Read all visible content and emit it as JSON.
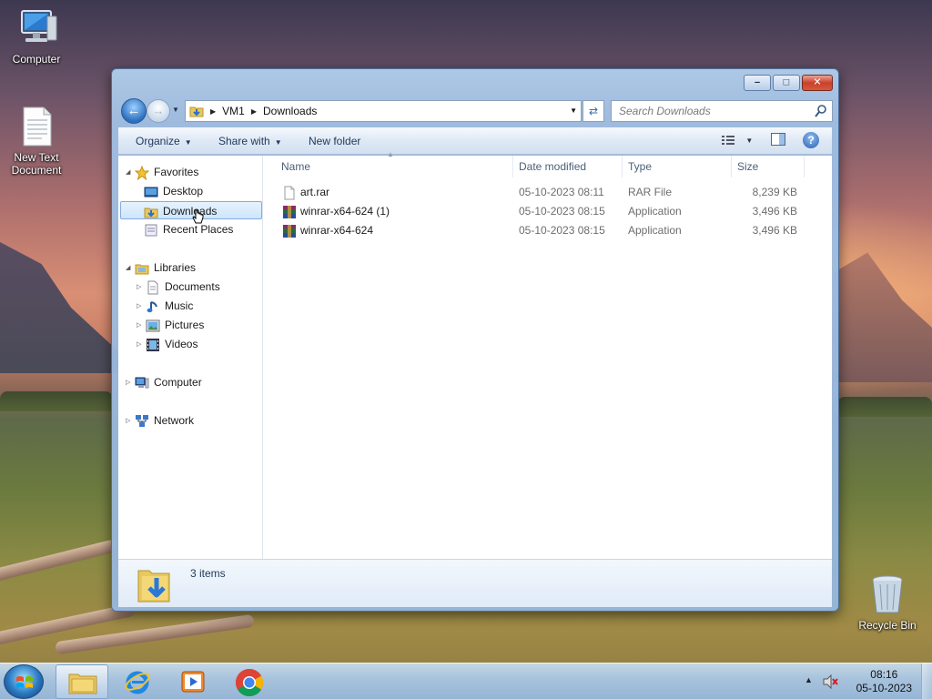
{
  "desktop": {
    "icons": [
      {
        "label": "Computer"
      },
      {
        "label": "New Text Document"
      },
      {
        "label": "Recycle Bin"
      }
    ]
  },
  "window": {
    "caption_buttons": {
      "minimize": "–",
      "maximize": "□",
      "close": "✕"
    },
    "address": {
      "breadcrumbs": [
        "VM1",
        "Downloads"
      ]
    },
    "search": {
      "placeholder": "Search Downloads"
    },
    "commands": {
      "organize": "Organize",
      "share_with": "Share with",
      "new_folder": "New folder"
    },
    "tree": {
      "favorites": {
        "label": "Favorites",
        "items": [
          "Desktop",
          "Downloads",
          "Recent Places"
        ]
      },
      "libraries": {
        "label": "Libraries",
        "items": [
          "Documents",
          "Music",
          "Pictures",
          "Videos"
        ]
      },
      "computer": "Computer",
      "network": "Network",
      "selected": "Downloads"
    },
    "columns": [
      "Name",
      "Date modified",
      "Type",
      "Size"
    ],
    "files": [
      {
        "name": "art.rar",
        "date": "05-10-2023 08:11",
        "type": "RAR File",
        "size": "8,239 KB",
        "icon": "rar-file-icon"
      },
      {
        "name": "winrar-x64-624 (1)",
        "date": "05-10-2023 08:15",
        "type": "Application",
        "size": "3,496 KB",
        "icon": "winrar-app-icon"
      },
      {
        "name": "winrar-x64-624",
        "date": "05-10-2023 08:15",
        "type": "Application",
        "size": "3,496 KB",
        "icon": "winrar-app-icon"
      }
    ],
    "status": {
      "items": "3 items"
    }
  },
  "taskbar": {
    "apps": [
      "windows-explorer",
      "internet-explorer",
      "media-player",
      "google-chrome"
    ],
    "clock": {
      "time": "08:16",
      "date": "05-10-2023"
    }
  },
  "colors": {
    "selection": "#cde6fb",
    "selection_border": "#84acdd",
    "header_text": "#4c607a",
    "link_text": "#1e395b"
  }
}
